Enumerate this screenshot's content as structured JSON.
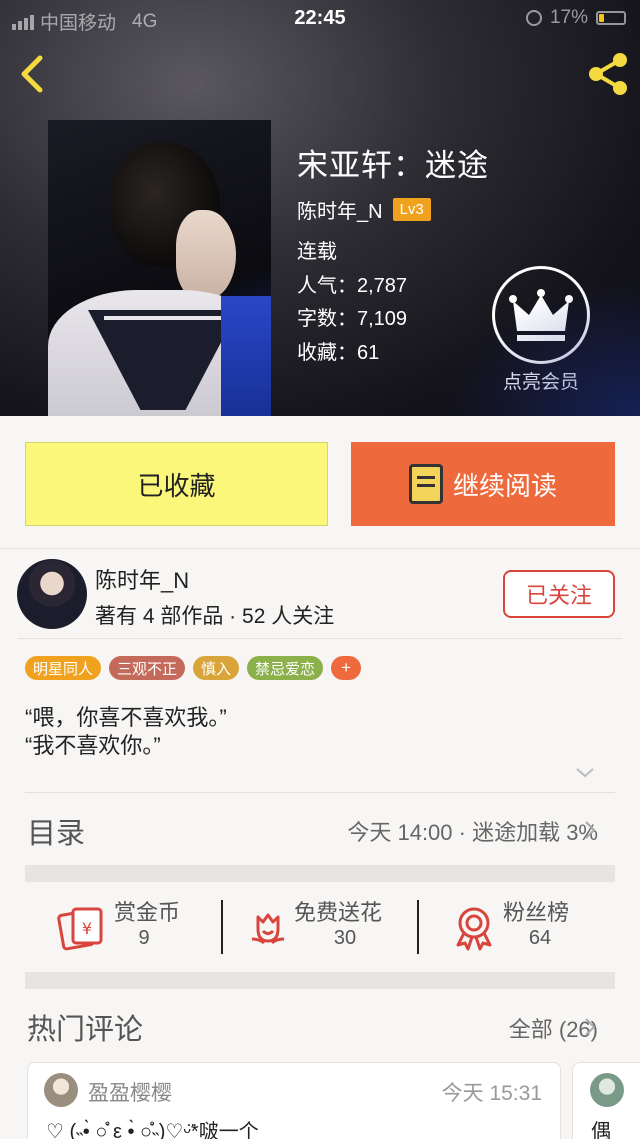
{
  "status_bar": {
    "carrier": "中国移动",
    "network": "4G",
    "time": "22:45",
    "battery": "17%"
  },
  "book": {
    "title": "宋亚轩：迷途",
    "author": "陈时年_N",
    "level": "Lv3",
    "status": "连载",
    "popularity": "人气：2,787",
    "word_count": "字数：7,109",
    "favorites": "收藏：61",
    "vip_label": "点亮会员"
  },
  "actions": {
    "collected_label": "已收藏",
    "read_label": "继续阅读"
  },
  "author_card": {
    "name": "陈时年_N",
    "stats": "著有 4 部作品 · 52 人关注",
    "follow_label": "已关注"
  },
  "tags": [
    {
      "label": "明星同人",
      "color": "#f0a21f"
    },
    {
      "label": "三观不正",
      "color": "#c46a5a"
    },
    {
      "label": "慎入",
      "color": "#d9a53a"
    },
    {
      "label": "禁忌爱恋",
      "color": "#8cb04a"
    }
  ],
  "tag_more": "+",
  "summary": {
    "line1": "“喂，你喜不喜欢我。”",
    "line2": "“我不喜欢你。”"
  },
  "toc": {
    "title": "目录",
    "update": "今天 14:00 · 迷途加载 3%"
  },
  "stats": [
    {
      "label": "赏金币",
      "value": "9",
      "icon": "red-envelope-icon"
    },
    {
      "label": "免费送花",
      "value": "30",
      "icon": "flower-icon"
    },
    {
      "label": "粉丝榜",
      "value": "64",
      "icon": "ribbon-medal-icon"
    }
  ],
  "comments": {
    "title": "热门评论",
    "all_label": "全部 (26)",
    "items": [
      {
        "user": "盈盈樱樱",
        "time": "今天 15:31",
        "text": "♡ (˵•̀ ○̇̊ ε •̀ ○̇̊˵)♡ᵕ̈*啵一个"
      },
      {
        "text": "偶"
      }
    ]
  },
  "colors": {
    "accent_orange": "#ee6a3c",
    "collected_yellow": "#fbf77a",
    "level_badge": "#f0a21f",
    "follow_red": "#d9443c"
  }
}
